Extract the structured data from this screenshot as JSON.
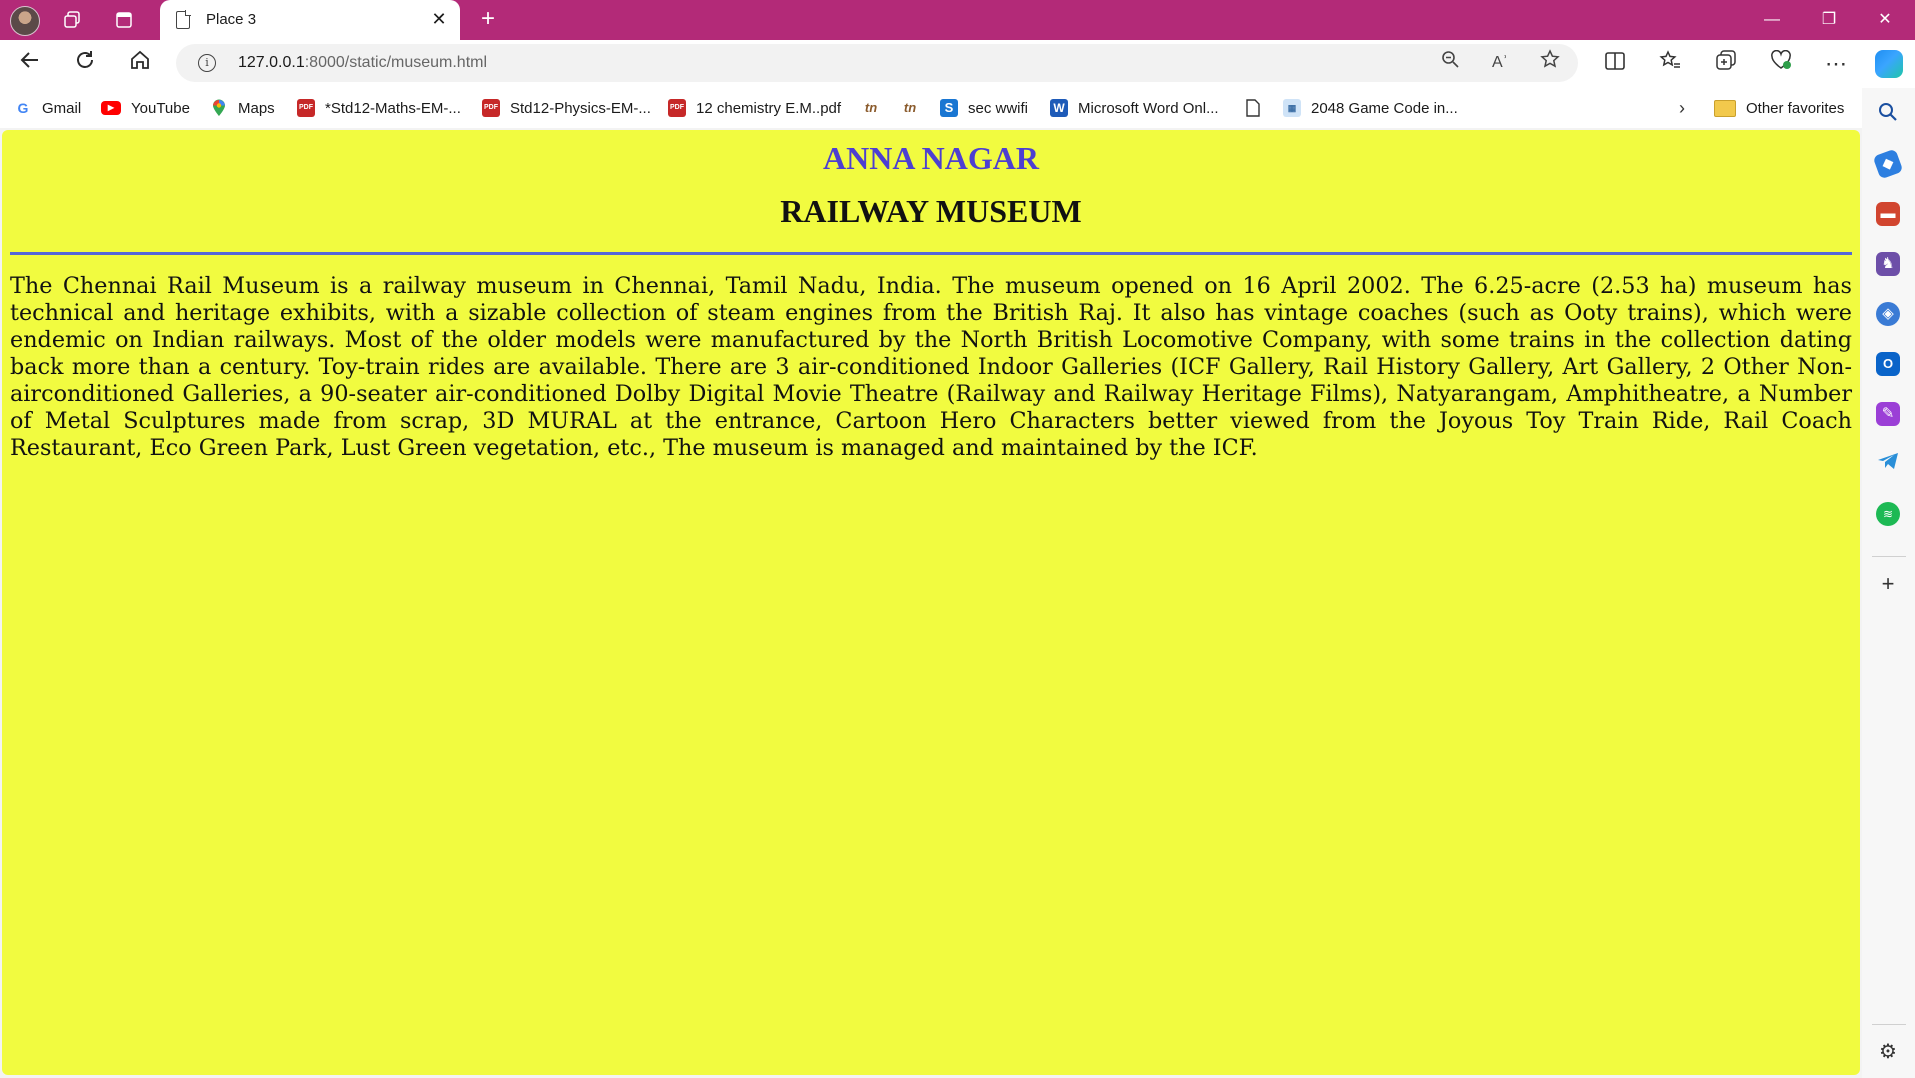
{
  "browser": {
    "tab": {
      "title": "Place 3",
      "close_glyph": "✕"
    },
    "new_tab_glyph": "+",
    "window_controls": {
      "minimize": "—",
      "restore": "❐",
      "close": "✕"
    },
    "url": {
      "host": "127.0.0.1",
      "rest": ":8000/static/museum.html"
    },
    "toolbar_icons": [
      "back-arrow-icon",
      "refresh-icon",
      "home-icon",
      "zoom-out-icon",
      "read-aloud-icon",
      "favorite-star-icon",
      "split-screen-icon",
      "favorites-icon",
      "collections-icon",
      "browser-essentials-icon",
      "more-icon",
      "copilot-icon"
    ],
    "read_aloud_label": "Aʾ",
    "favorites": [
      {
        "label": "Gmail",
        "icon": "google-icon"
      },
      {
        "label": "YouTube",
        "icon": "youtube-icon"
      },
      {
        "label": "Maps",
        "icon": "maps-pin-icon"
      },
      {
        "label": "*Std12-Maths-EM-...",
        "icon": "pdf-icon"
      },
      {
        "label": "Std12-Physics-EM-...",
        "icon": "pdf-icon"
      },
      {
        "label": "12 chemistry E.M..pdf",
        "icon": "pdf-icon"
      },
      {
        "label": "",
        "icon": "tn-logo-icon"
      },
      {
        "label": "",
        "icon": "tn-logo-icon"
      },
      {
        "label": "sec wwifi",
        "icon": "s-icon"
      },
      {
        "label": "Microsoft Word Onl...",
        "icon": "word-icon"
      },
      {
        "label": "",
        "icon": "document-icon"
      },
      {
        "label": "2048 Game Code in...",
        "icon": "game-icon"
      }
    ],
    "other_favorites": "Other favorites",
    "colors": {
      "titlebar": "#b32a78",
      "page_bg": "#f1fb40",
      "city_heading": "#4d3fd1",
      "rule": "#5566d8"
    }
  },
  "page": {
    "city": "ANNA NAGAR",
    "title": "RAILWAY MUSEUM",
    "body": "The Chennai Rail Museum is a railway museum in Chennai, Tamil Nadu, India. The museum opened on 16 April 2002. The 6.25-acre (2.53 ha) museum has technical and heritage exhibits, with a sizable collection of steam engines from the British Raj. It also has vintage coaches (such as Ooty trains), which were endemic on Indian railways. Most of the older models were manufactured by the North British Locomotive Company, with some trains in the collection dating back more than a century. Toy-train rides are available. There are 3 air-conditioned Indoor Galleries (ICF Gallery, Rail History Gallery, Art Gallery, 2 Other Non-airconditioned Galleries, a 90-seater air-conditioned Dolby Digital Movie Theatre (Railway and Railway Heritage Films), Natyarangam, Amphitheatre, a Number of Metal Sculptures made from scrap, 3D MURAL at the entrance, Cartoon Hero Characters better viewed from the Joyous Toy Train Ride, Rail Coach Restaurant, Eco Green Park, Lust Green vegetation, etc., The museum is managed and maintained by the ICF."
  },
  "sidebar_icons": [
    "search-icon",
    "shopping-tag-icon",
    "tools-icon",
    "games-icon",
    "microsoft-365-icon",
    "outlook-icon",
    "designer-icon",
    "telegram-icon",
    "spotify-icon",
    "add-icon",
    "settings-icon"
  ]
}
